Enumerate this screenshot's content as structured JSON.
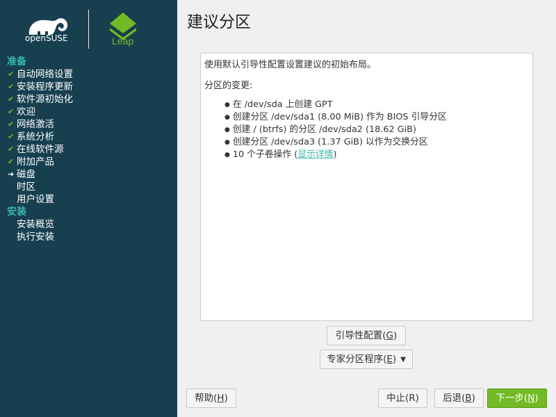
{
  "brand": {
    "opensuse_text": "openSUSE",
    "leap_text": "Leap",
    "colors": {
      "sidebar": "#173f4f",
      "accent_teal": "#35b9ab",
      "accent_green": "#73ba25"
    }
  },
  "sidebar": {
    "sections": [
      {
        "label": "准备",
        "steps": [
          {
            "label": "自动网络设置",
            "state": "done"
          },
          {
            "label": "安装程序更新",
            "state": "done"
          },
          {
            "label": "软件源初始化",
            "state": "done"
          },
          {
            "label": "欢迎",
            "state": "done"
          },
          {
            "label": "网络激活",
            "state": "done"
          },
          {
            "label": "系统分析",
            "state": "done"
          },
          {
            "label": "在线软件源",
            "state": "done"
          },
          {
            "label": "附加产品",
            "state": "done"
          },
          {
            "label": "磁盘",
            "state": "current"
          },
          {
            "label": "时区",
            "state": "pending"
          },
          {
            "label": "用户设置",
            "state": "pending"
          }
        ]
      },
      {
        "label": "安装",
        "steps": [
          {
            "label": "安装概览",
            "state": "pending"
          },
          {
            "label": "执行安装",
            "state": "pending"
          }
        ]
      }
    ]
  },
  "main": {
    "title": "建议分区",
    "intro": "使用默认引导性配置设置建议的初始布局。",
    "changes_heading": "分区的变更:",
    "changes": [
      "在 /dev/sda 上创建 GPT",
      "创建分区 /dev/sda1 (8.00 MiB) 作为 BIOS 引导分区",
      "创建 / (btrfs) 的分区 /dev/sda2 (18.62 GiB)",
      "创建分区 /dev/sda3 (1.37 GiB) 以作为交换分区"
    ],
    "subvolume_text": "10 个子卷操作 (",
    "subvolume_link": "显示详情",
    "subvolume_close": ")"
  },
  "buttons": {
    "guided": {
      "label": "引导性配置(",
      "key": "G",
      "end": ")"
    },
    "expert": {
      "label": "专家分区程序(",
      "key": "E",
      "end": ")"
    },
    "help": {
      "label": "帮助(",
      "key": "H",
      "end": ")"
    },
    "abort": {
      "label": "中止(R)"
    },
    "back": {
      "label": "后退(",
      "key": "B",
      "end": ")"
    },
    "next": {
      "label": "下一步(",
      "key": "N",
      "end": ")"
    }
  }
}
